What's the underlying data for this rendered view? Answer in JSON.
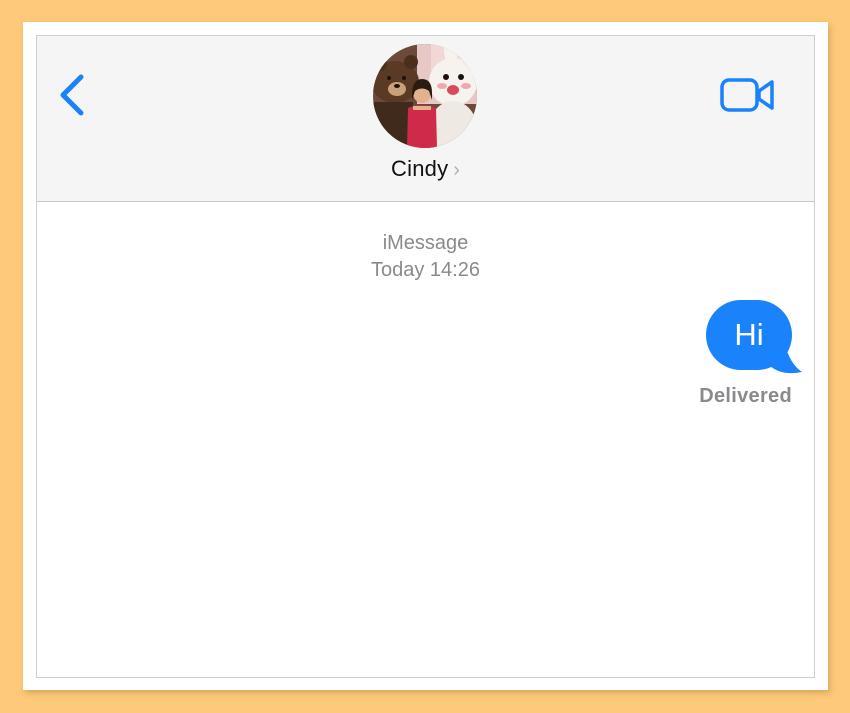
{
  "header": {
    "contact_name": "Cindy",
    "name_chevron": "›",
    "back_icon": "chevron-left-icon",
    "video_icon": "video-camera-icon",
    "avatar_desc": "contact-avatar-photo"
  },
  "conversation": {
    "service": "iMessage",
    "timestamp": "Today 14:26",
    "messages": [
      {
        "direction": "outgoing",
        "text": "Hi",
        "status": "Delivered"
      }
    ]
  },
  "colors": {
    "accent": "#1a82fb",
    "outer_background": "#fec97a",
    "header_background": "#f5f5f5",
    "secondary_text": "#8a8a8e"
  }
}
